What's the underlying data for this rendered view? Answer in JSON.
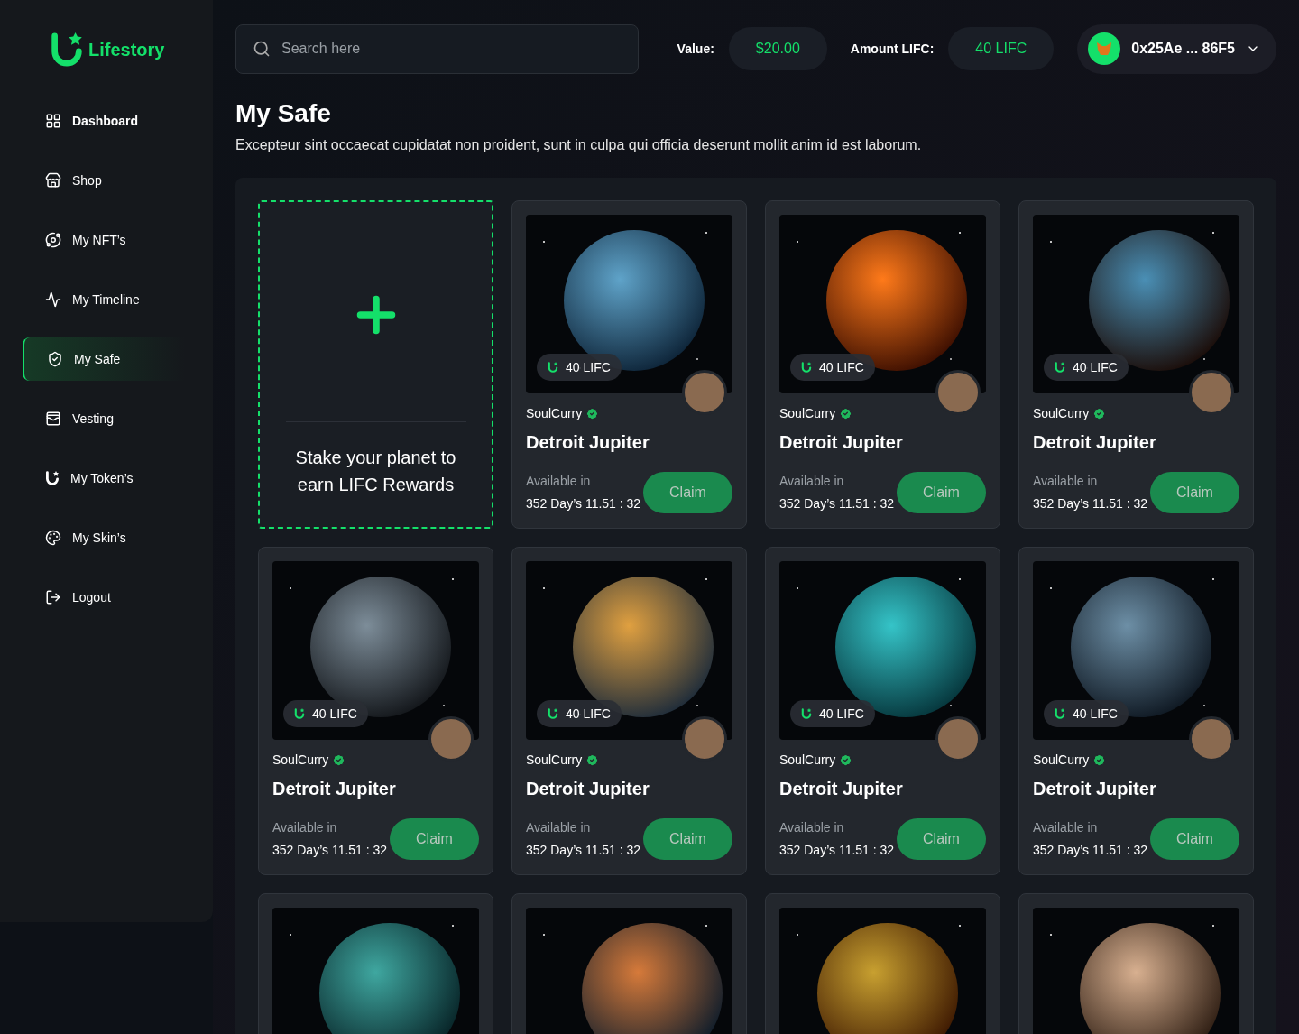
{
  "brand": "Lifestory",
  "sidebar": {
    "items": [
      {
        "label": "Dashboard",
        "selected": false
      },
      {
        "label": "Shop",
        "selected": false
      },
      {
        "label": "My NFT’s",
        "selected": false
      },
      {
        "label": "My Timeline",
        "selected": false
      },
      {
        "label": "My Safe",
        "selected": true
      },
      {
        "label": "Vesting",
        "selected": false
      },
      {
        "label": "My Token’s",
        "selected": false
      },
      {
        "label": "My Skin’s",
        "selected": false
      },
      {
        "label": "Logout",
        "selected": false
      }
    ]
  },
  "search": {
    "placeholder": "Search here"
  },
  "stats": [
    {
      "label": "Value:",
      "value": "$20.00"
    },
    {
      "label": "Amount LIFC:",
      "value": "40 LIFC"
    }
  ],
  "wallet": {
    "address": "0x25Ae ... 86F5"
  },
  "page": {
    "title": "My Safe",
    "description": "Excepteur sint occaecat cupidatat non proident, sunt in culpa qui officia deserunt mollit anim id est laborum."
  },
  "cards": [
    {
      "kind": "add",
      "text": "Stake your planet to earn LIFC Rewards"
    },
    {
      "kind": "nft",
      "price": "40 LIFC",
      "creator": "SoulCurry",
      "verified": true,
      "title": "Detroit Jupiter",
      "available_label": "Available in",
      "countdown": "352 Day’s 11.51 : 32",
      "button": "Claim"
    },
    {
      "kind": "nft",
      "price": "40 LIFC",
      "creator": "SoulCurry",
      "verified": true,
      "title": "Detroit Jupiter",
      "available_label": "Available in",
      "countdown": "352 Day’s 11.51 : 32",
      "button": "Claim"
    },
    {
      "kind": "nft",
      "price": "40 LIFC",
      "creator": "SoulCurry",
      "verified": true,
      "title": "Detroit Jupiter",
      "available_label": "Available in",
      "countdown": "352 Day’s 11.51 : 32",
      "button": "Claim"
    },
    {
      "kind": "nft",
      "price": "40 LIFC",
      "creator": "SoulCurry",
      "verified": true,
      "title": "Detroit Jupiter",
      "available_label": "Available in",
      "countdown": "352 Day’s 11.51 : 32",
      "button": "Claim"
    },
    {
      "kind": "nft",
      "price": "40 LIFC",
      "creator": "SoulCurry",
      "verified": true,
      "title": "Detroit Jupiter",
      "available_label": "Available in",
      "countdown": "352 Day’s 11.51 : 32",
      "button": "Claim"
    },
    {
      "kind": "nft",
      "price": "40 LIFC",
      "creator": "SoulCurry",
      "verified": true,
      "title": "Detroit Jupiter",
      "available_label": "Available in",
      "countdown": "352 Day’s 11.51 : 32",
      "button": "Claim"
    },
    {
      "kind": "nft",
      "price": "40 LIFC",
      "creator": "SoulCurry",
      "verified": true,
      "title": "Detroit Jupiter",
      "available_label": "Available in",
      "countdown": "352 Day’s 11.51 : 32",
      "button": "Claim"
    },
    {
      "kind": "image"
    },
    {
      "kind": "image"
    },
    {
      "kind": "image"
    },
    {
      "kind": "image"
    }
  ]
}
